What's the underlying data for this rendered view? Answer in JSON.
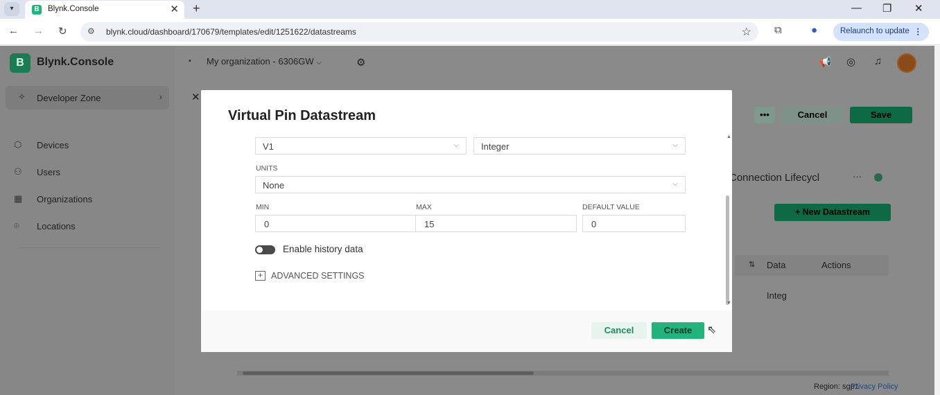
{
  "browser": {
    "tab_title": "Blynk.Console",
    "tab_favicon": "B",
    "url": "blynk.cloud/dashboard/170679/templates/edit/1251622/datastreams",
    "relaunch_label": "Relaunch to update"
  },
  "app": {
    "logo_letter": "B",
    "brand": "Blynk.Console",
    "organization": "My organization - 6306GW",
    "sidebar": {
      "dev_zone": "Developer Zone",
      "items": [
        {
          "label": "Devices",
          "icon": "cube-icon"
        },
        {
          "label": "Users",
          "icon": "users-icon"
        },
        {
          "label": "Organizations",
          "icon": "building-icon"
        },
        {
          "label": "Locations",
          "icon": "pin-icon"
        }
      ]
    },
    "header_actions": {
      "more": "•••",
      "cancel": "Cancel",
      "save": "Save"
    },
    "background": {
      "section_title": "Connection Lifecycl",
      "section_more": "···",
      "new_datastream": "+ New Datastream",
      "col_data": "Data",
      "col_actions": "Actions",
      "cell_type": "Integ",
      "region": "Region: sgp1",
      "privacy": "Privacy Policy"
    }
  },
  "modal": {
    "title": "Virtual Pin Datastream",
    "pin": "V1",
    "data_type": "Integer",
    "units_label": "UNITS",
    "units_value": "None",
    "min_label": "MIN",
    "min_value": "0",
    "max_label": "MAX",
    "max_value": "15",
    "default_label": "DEFAULT VALUE",
    "default_value": "0",
    "history_toggle_label": "Enable history data",
    "advanced_label": "ADVANCED SETTINGS",
    "cancel_label": "Cancel",
    "create_label": "Create"
  },
  "colors": {
    "brand_green": "#23b47e",
    "overlay": "#8a8a8a"
  }
}
